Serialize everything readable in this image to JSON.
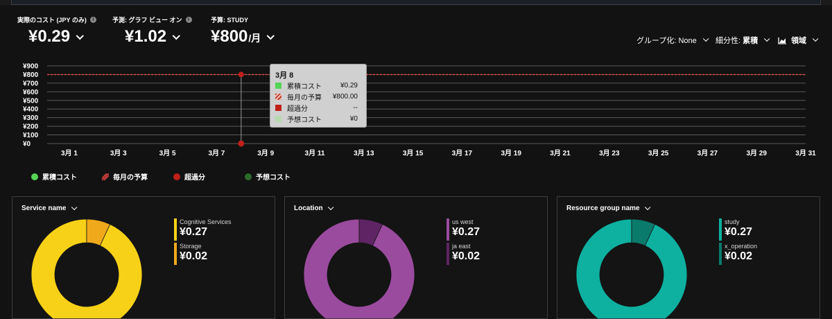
{
  "kpis": [
    {
      "label": "実際のコスト (JPY のみ)",
      "value": "¥0.29",
      "unit": ""
    },
    {
      "label": "予測: グラフ ビュー オン",
      "value": "¥1.02",
      "unit": ""
    },
    {
      "label": "予算: STUDY",
      "value": "¥800",
      "unit": "/月"
    }
  ],
  "filters": {
    "group_by": "グループ化: None",
    "granularity_label": "細分性: ",
    "granularity_value": "累積",
    "view": "領域",
    "view_icon": "area-chart-icon"
  },
  "colors": {
    "accumulated": "#55d455",
    "budget": "#e0433f",
    "over": "#c0201a",
    "forecast": "#2a6b2a",
    "forecast_light": "#b8d8b0",
    "gridline": "#5a5a5a",
    "cognitive": "#f7d117",
    "storage": "#f0a91b",
    "us_west": "#9a4b9e",
    "ja_east": "#5e2464",
    "study": "#0eb0a0",
    "x_operation": "#0a7a6c"
  },
  "chart_data": {
    "type": "area",
    "y_ticks": [
      "¥0",
      "¥100",
      "¥200",
      "¥300",
      "¥400",
      "¥500",
      "¥600",
      "¥700",
      "¥800",
      "¥900"
    ],
    "ylim": [
      0,
      900
    ],
    "x_ticks": [
      "3月 1",
      "3月 3",
      "3月 5",
      "3月 7",
      "3月 9",
      "3月 11",
      "3月 13",
      "3月 15",
      "3月 17",
      "3月 19",
      "3月 21",
      "3月 23",
      "3月 25",
      "3月 27",
      "3月 29",
      "3月 31"
    ],
    "x_tick_days": [
      1,
      3,
      5,
      7,
      9,
      11,
      13,
      15,
      17,
      19,
      21,
      23,
      25,
      27,
      29,
      31
    ],
    "xlim": [
      1,
      31
    ],
    "budget_value": 800,
    "series": [
      {
        "name": "累積コスト",
        "x": [
          8
        ],
        "y": [
          0.29
        ]
      },
      {
        "name": "毎月の予算",
        "value": 800
      },
      {
        "name": "超過分",
        "x": [
          8
        ],
        "y": [
          800
        ]
      },
      {
        "name": "予想コスト",
        "x": [
          8
        ],
        "y": [
          0
        ]
      }
    ],
    "hover_day": 8,
    "grid": true,
    "legend_position": "bottom-left"
  },
  "tooltip": {
    "date": "3月 8",
    "rows": [
      {
        "name": "累積コスト",
        "value": "¥0.29"
      },
      {
        "name": "毎月の予算",
        "value": "¥800.00"
      },
      {
        "name": "超過分",
        "value": "--"
      },
      {
        "name": "予想コスト",
        "value": "¥0"
      }
    ]
  },
  "legend": [
    "累積コスト",
    "毎月の予算",
    "超過分",
    "予想コスト"
  ],
  "cards": [
    {
      "title": "Service name",
      "items": [
        {
          "name": "Cognitive Services",
          "value": "¥0.27",
          "share": 0.27
        },
        {
          "name": "Storage",
          "value": "¥0.02",
          "share": 0.02
        }
      ]
    },
    {
      "title": "Location",
      "items": [
        {
          "name": "us west",
          "value": "¥0.27",
          "share": 0.27
        },
        {
          "name": "ja east",
          "value": "¥0.02",
          "share": 0.02
        }
      ]
    },
    {
      "title": "Resource group name",
      "items": [
        {
          "name": "study",
          "value": "¥0.27",
          "share": 0.27
        },
        {
          "name": "x_operation",
          "value": "¥0.02",
          "share": 0.02
        }
      ]
    }
  ]
}
